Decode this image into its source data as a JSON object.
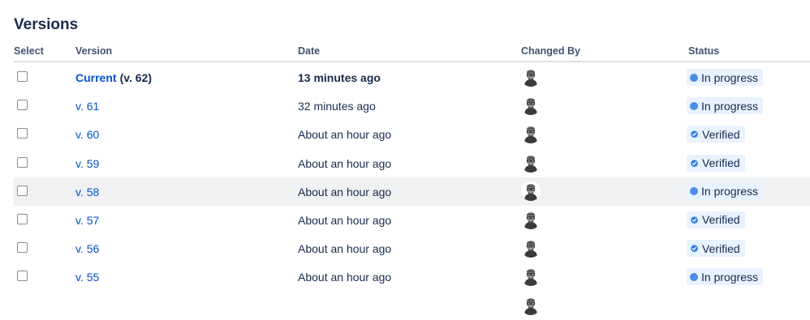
{
  "page": {
    "title": "Versions"
  },
  "columns": {
    "select": "Select",
    "version": "Version",
    "date": "Date",
    "changed_by": "Changed By",
    "status": "Status"
  },
  "rows": [
    {
      "version_link": "Current",
      "version_suffix": "(v. 62)",
      "date": "13 minutes ago",
      "status": "In progress",
      "status_icon": "progress-dot-icon",
      "emphasis": true
    },
    {
      "version_link": "v. 61",
      "version_suffix": "",
      "date": "32 minutes ago",
      "status": "In progress",
      "status_icon": "progress-dot-icon"
    },
    {
      "version_link": "v. 60",
      "version_suffix": "",
      "date": "About an hour ago",
      "status": "Verified",
      "status_icon": "verified-check-icon"
    },
    {
      "version_link": "v. 59",
      "version_suffix": "",
      "date": "About an hour ago",
      "status": "Verified",
      "status_icon": "verified-check-icon"
    },
    {
      "version_link": "v. 58",
      "version_suffix": "",
      "date": "About an hour ago",
      "status": "In progress",
      "status_icon": "progress-dot-icon",
      "hovered": true
    },
    {
      "version_link": "v. 57",
      "version_suffix": "",
      "date": "About an hour ago",
      "status": "Verified",
      "status_icon": "verified-check-icon"
    },
    {
      "version_link": "v. 56",
      "version_suffix": "",
      "date": "About an hour ago",
      "status": "Verified",
      "status_icon": "verified-check-icon"
    },
    {
      "version_link": "v. 55",
      "version_suffix": "",
      "date": "About an hour ago",
      "status": "In progress",
      "status_icon": "progress-dot-icon"
    }
  ],
  "colors": {
    "link": "#0052cc",
    "status_bg": "#e9f2ff",
    "status_dot": "#4c8ee5",
    "hover_row": "#f0f1f3"
  }
}
